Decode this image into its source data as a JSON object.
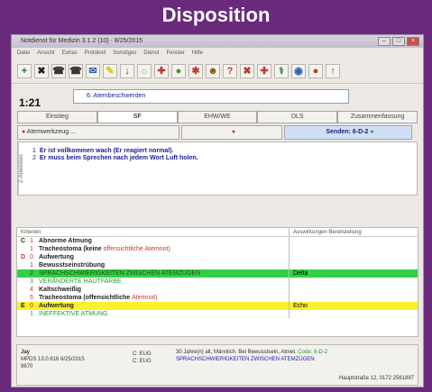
{
  "banner": {
    "title": "Disposition"
  },
  "window": {
    "title": "Notdienst für Medizin 3.1.2 (10) · 8/25/2015",
    "menu": [
      "Datei",
      "Ansicht",
      "Extras",
      "Protokoll",
      "Sonstiges",
      "Dienst",
      "Fenster",
      "Hilfe"
    ]
  },
  "toolbar": {
    "icons": [
      "+",
      "✖",
      "☎",
      "☎",
      "✉",
      "✎",
      "↓",
      "☼",
      "✚",
      "●",
      "✱",
      "☻",
      "?",
      "✖",
      "✚",
      "⚕",
      "◉",
      "●",
      "↑"
    ]
  },
  "header": {
    "timer": "1:21",
    "field": "6: Atembeschwerden"
  },
  "tabs": [
    "Einstieg",
    "SF",
    "EHW/WE",
    "DLS",
    "Zusammenfassung"
  ],
  "actions": {
    "a": "Atemwerkzeug ...",
    "b": "",
    "c": "Senden: 6-D-2"
  },
  "questions": {
    "side": "Z-Anweisen",
    "items": [
      {
        "num": "1",
        "text": "Er ist vollkommen wach (Er reagiert normal)."
      },
      {
        "num": "2",
        "text": "Er muss beim Sprechen nach jedem Wort Luft holen."
      }
    ]
  },
  "grid": {
    "head_a": "Kriterien",
    "head_b": "Auswirkungen Bereitstellung",
    "rows": [
      {
        "code": "C",
        "num": "1",
        "text": "Abnorme Atmung",
        "note": "",
        "extra": ""
      },
      {
        "code": "",
        "num": "1",
        "text": "Tracheostoma (keine ",
        "note": "offensichtliche Atemnot)",
        "extra": ""
      },
      {
        "code": "D",
        "num": "0",
        "text": "Aufwertung",
        "note": "",
        "extra": ""
      },
      {
        "code": "",
        "num": "1",
        "text": "Bewusstseinstrübung",
        "note": "",
        "extra": ""
      },
      {
        "code": "",
        "num": "2",
        "text": "SPRACHSCHWIERIGKEITEN ZWISCHEN ATEMZÜGEN",
        "note": "",
        "extra": "Delta"
      },
      {
        "code": "",
        "num": "3",
        "text": "VERÄNDERTE HAUTFARBE",
        "note": "",
        "extra": ""
      },
      {
        "code": "",
        "num": "4",
        "text": "Kaltschweißig",
        "note": "",
        "extra": ""
      },
      {
        "code": "",
        "num": "5",
        "text": "Tracheostoma (offensichtliche ",
        "note": "Atemnot)",
        "extra": ""
      },
      {
        "code": "E",
        "num": "0",
        "text": "Aufwertung",
        "note": "",
        "extra": "Echo"
      },
      {
        "code": "",
        "num": "1",
        "text": "INEFFEKTIVE ATMUNG",
        "note": "",
        "extra": ""
      }
    ]
  },
  "bottom": {
    "name": "Jay",
    "line2": "MPDS 13.0.616 8/25/2015",
    "line3": "9670",
    "mid1": "C: EUG",
    "mid2": "C: EUG",
    "info": "30 Jahre(n) alt, Männlich. Bei Bewusstsein, Atmet.",
    "code": " Code: 6-D-2",
    "phrase": "SPRACHSCHWIERIGKEITEN ZWISCHEN ATEMZÜGEN",
    "address": "Hauptstraße 12, 0172 2561897"
  },
  "colors": {
    "banner": "#6a2a7c",
    "green_row": "#34d043",
    "yellow_row": "#fbf02d",
    "send": "#cfe0f5"
  }
}
